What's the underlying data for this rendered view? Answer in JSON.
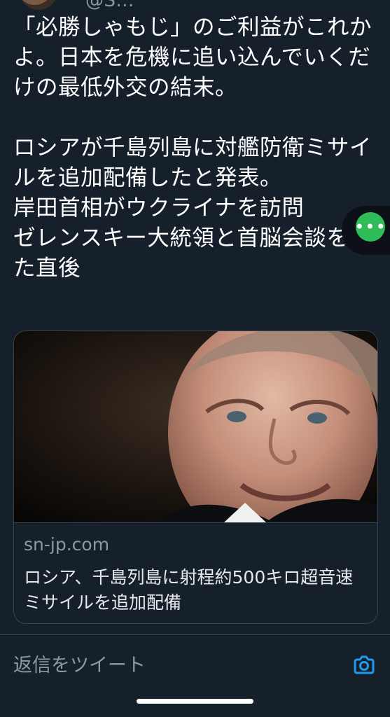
{
  "tweet": {
    "handle": "@S...",
    "text": "「必勝しゃもじ」のご利益がこれかよ。日本を危機に追い込んでいくだけの最低外交の結末。\n\nロシアが千島列島に対艦防衛ミサイルを追加配備したと発表。\n岸田首相がウクライナを訪問\nゼレンスキー大統領と首脳会談をした直後"
  },
  "card": {
    "domain": "sn-jp.com",
    "title": "ロシア、千島列島に射程約500キロ超音速ミサイルを追加配備"
  },
  "reply": {
    "placeholder": "返信をツイート"
  },
  "floating": {
    "more_label": "•••"
  },
  "colors": {
    "background": "#15202b",
    "accent": "#1d9bf0",
    "floating_button": "#2ebd59",
    "border": "#38444d",
    "secondary_text": "#8b98a5"
  },
  "icons": {
    "reply_camera": "camera-icon",
    "floating_more": "more-horizontal-icon"
  }
}
